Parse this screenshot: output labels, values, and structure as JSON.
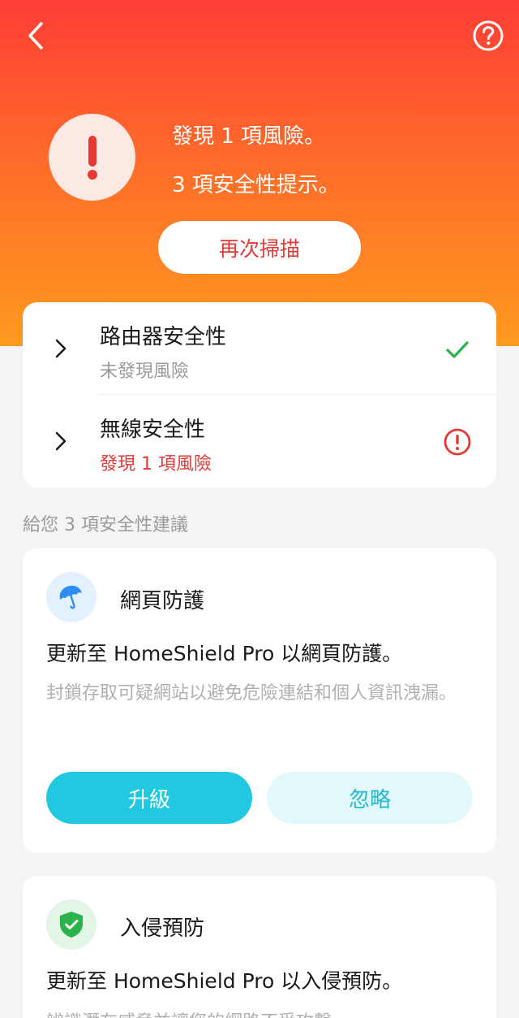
{
  "header": {
    "back_icon": "chevron-left-icon",
    "help_icon": "question-circle-icon",
    "risk_icon": "exclamation-icon",
    "risk_summary": "發現 1 項風險。",
    "tips_summary": "3 項安全性提示。",
    "rescan_label": "再次掃描",
    "gradient_colors": [
      "#ff3d36",
      "#ff6a2a",
      "#ff9a1f"
    ]
  },
  "status": {
    "items": [
      {
        "title": "路由器安全性",
        "subtitle": "未發現風險",
        "state": "ok",
        "icon": "check-icon",
        "color": "#2ab24d"
      },
      {
        "title": "無線安全性",
        "subtitle": "發現 1 項風險",
        "state": "risk",
        "icon": "alert-circle-icon",
        "color": "#e53935"
      }
    ]
  },
  "suggestions": {
    "title": "給您 3 項安全性建議",
    "cards": [
      {
        "name": "網頁防護",
        "icon": "umbrella-icon",
        "headline": "更新至 HomeShield Pro 以網頁防護。",
        "description": "封鎖存取可疑網站以避免危險連結和個人資訊洩漏。",
        "upgrade_label": "升級",
        "ignore_label": "忽略"
      },
      {
        "name": "入侵預防",
        "icon": "shield-check-icon",
        "headline": "更新至 HomeShield Pro 以入侵預防。",
        "description": "辨識潛在威脅並讓您的網路不受攻擊。"
      }
    ]
  },
  "colors": {
    "accent": "#22c8e0",
    "danger": "#e53935",
    "success": "#2ab24d"
  }
}
